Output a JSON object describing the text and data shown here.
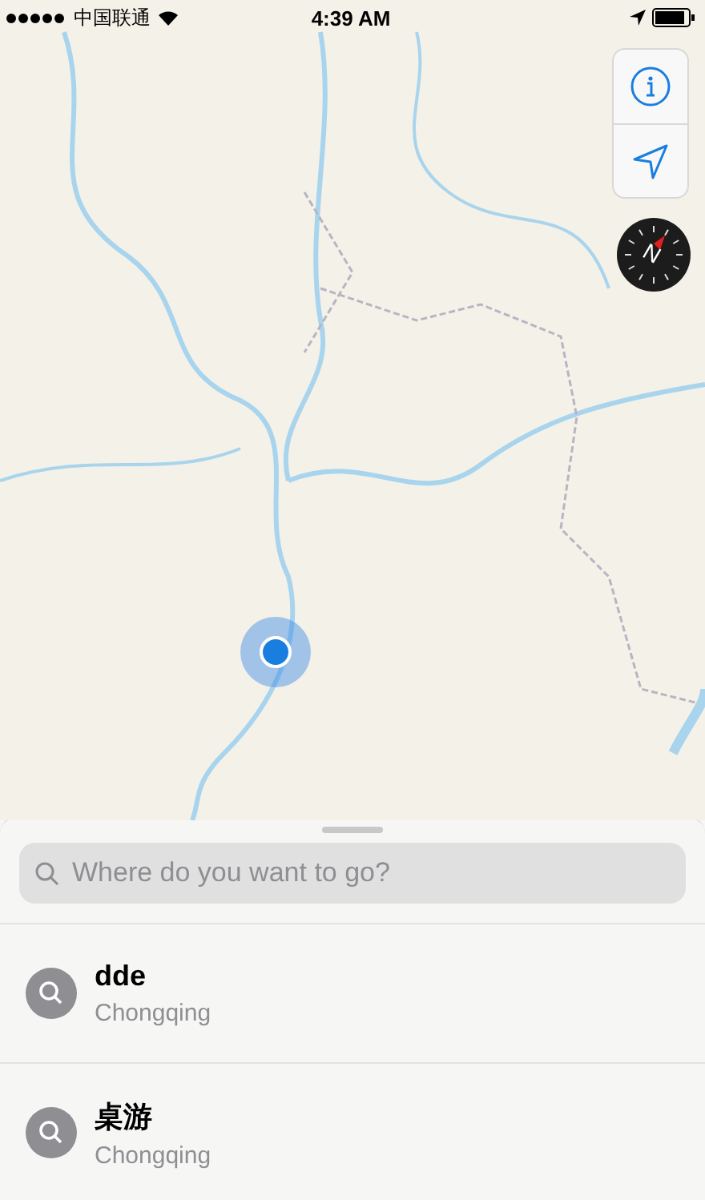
{
  "status_bar": {
    "carrier": "中国联通",
    "time": "4:39 AM"
  },
  "compass": {
    "label": "N"
  },
  "search": {
    "placeholder": "Where do you want to go?"
  },
  "recents": [
    {
      "title": "dde",
      "subtitle": "Chongqing"
    },
    {
      "title": "桌游",
      "subtitle": "Chongqing"
    }
  ]
}
